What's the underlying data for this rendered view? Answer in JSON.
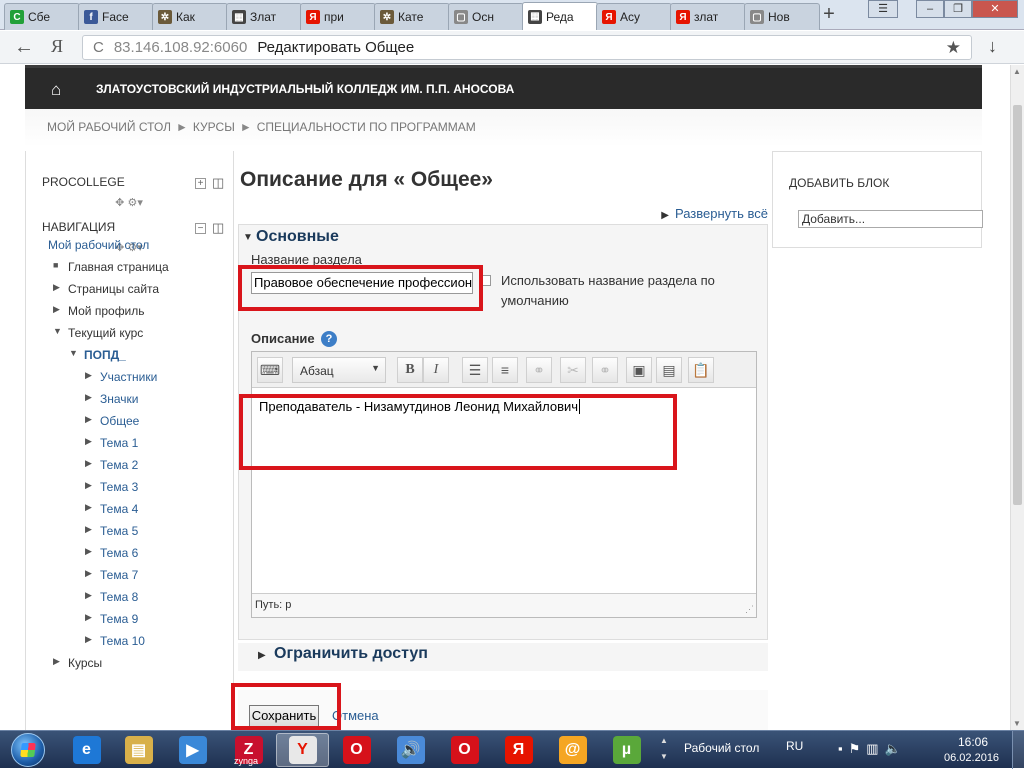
{
  "browser": {
    "tabs": [
      {
        "label": "Сбе",
        "icon": "sberbank-icon",
        "color": "#21a038",
        "glyph": "С"
      },
      {
        "label": "Face",
        "icon": "facebook-icon",
        "color": "#3b5998",
        "glyph": "f"
      },
      {
        "label": "Как",
        "icon": "puzzle-icon",
        "color": "#6b5a3a",
        "glyph": "✲"
      },
      {
        "label": "Злат",
        "icon": "moodle-icon",
        "color": "#444444",
        "glyph": "▦"
      },
      {
        "label": "при",
        "icon": "yandex-icon",
        "color": "#e61400",
        "glyph": "Я"
      },
      {
        "label": "Кате",
        "icon": "puzzle-icon",
        "color": "#6b5a3a",
        "glyph": "✲"
      },
      {
        "label": "Осн",
        "icon": "page-icon",
        "color": "#888888",
        "glyph": "▢"
      },
      {
        "label": "Реда",
        "icon": "moodle-icon",
        "color": "#444444",
        "glyph": "▦",
        "active": true
      },
      {
        "label": "Асу",
        "icon": "yandex-icon",
        "color": "#e61400",
        "glyph": "Я"
      },
      {
        "label": "злат",
        "icon": "yandex-icon",
        "color": "#e61400",
        "glyph": "Я"
      },
      {
        "label": "Нов",
        "icon": "page-icon",
        "color": "#888888",
        "glyph": "▢"
      }
    ],
    "new_tab": "+",
    "back": "←",
    "yandex_logo": "Я",
    "reload": "C",
    "url_host": "83.146.108.92:6060",
    "url_title": "Редактировать Общее",
    "star": "★",
    "download": "↓"
  },
  "site": {
    "home_icon": "⌂",
    "name": "Златоустовский индустриальный колледж им. П.П. Аносова"
  },
  "breadcrumbs": [
    "Мой рабочий стол",
    "Курсы",
    "Специальности по программам"
  ],
  "breadcrumb_sep": "►",
  "sidebar": {
    "block1_title": "PROCOLLEGE",
    "block2_title": "Навигация",
    "move_glyph": "✥",
    "gear_glyph": "⚙",
    "dropdown_glyph": "▾",
    "add_glyph": "+",
    "minus_glyph": "−",
    "dock_glyph": "◫",
    "items": [
      {
        "label": "Мой рабочий стол",
        "style": "blue",
        "bullet": ""
      },
      {
        "label": "Главная страница",
        "style": "dark",
        "bullet": "■"
      },
      {
        "label": "Страницы сайта",
        "style": "dark",
        "bullet": "▶"
      },
      {
        "label": "Мой профиль",
        "style": "dark",
        "bullet": "▶"
      },
      {
        "label": "Текущий курс",
        "style": "dark",
        "bullet": "▼"
      },
      {
        "label": "ПОПД_",
        "style": "blue-bold",
        "bullet": "▼"
      },
      {
        "label": "Участники",
        "style": "blue",
        "bullet": "▶"
      },
      {
        "label": "Значки",
        "style": "blue",
        "bullet": "▶"
      },
      {
        "label": "Общее",
        "style": "blue",
        "bullet": "▶"
      },
      {
        "label": "Тема 1",
        "style": "blue",
        "bullet": "▶"
      },
      {
        "label": "Тема 2",
        "style": "blue",
        "bullet": "▶"
      },
      {
        "label": "Тема 3",
        "style": "blue",
        "bullet": "▶"
      },
      {
        "label": "Тема 4",
        "style": "blue",
        "bullet": "▶"
      },
      {
        "label": "Тема 5",
        "style": "blue",
        "bullet": "▶"
      },
      {
        "label": "Тема 6",
        "style": "blue",
        "bullet": "▶"
      },
      {
        "label": "Тема 7",
        "style": "blue",
        "bullet": "▶"
      },
      {
        "label": "Тема 8",
        "style": "blue",
        "bullet": "▶"
      },
      {
        "label": "Тема 9",
        "style": "blue",
        "bullet": "▶"
      },
      {
        "label": "Тема 10",
        "style": "blue",
        "bullet": "▶"
      },
      {
        "label": "Курсы",
        "style": "dark",
        "bullet": "▶"
      }
    ]
  },
  "main": {
    "title": "Описание для « Общее»",
    "expand_all": "Развернуть всё",
    "expand_glyph": "▶",
    "section_general": "Основные",
    "collapse_glyph": "▼",
    "name_label": "Название раздела",
    "name_value": "Правовое обеспечение профессиональной деятельности",
    "use_default_label": "Использовать название раздела по умолчанию",
    "use_default_checked": false,
    "description_label": "Описание",
    "help_glyph": "?",
    "editor": {
      "format_value": "Абзац",
      "format_arrow": "▼",
      "buttons": [
        {
          "name": "toolbar-toggle-icon",
          "glyph": "⌨",
          "disabled": false
        },
        {
          "name": "bold-icon",
          "glyph": "B",
          "disabled": false
        },
        {
          "name": "italic-icon",
          "glyph": "I",
          "disabled": false
        },
        {
          "name": "bullet-list-icon",
          "glyph": "☰",
          "disabled": false
        },
        {
          "name": "numbered-list-icon",
          "glyph": "≡",
          "disabled": false
        },
        {
          "name": "link-icon",
          "glyph": "⚭",
          "disabled": true
        },
        {
          "name": "unlink-icon",
          "glyph": "✂",
          "disabled": true
        },
        {
          "name": "anchor-icon",
          "glyph": "⚭",
          "disabled": true
        },
        {
          "name": "image-icon",
          "glyph": "▣",
          "disabled": false
        },
        {
          "name": "media-icon",
          "glyph": "▤",
          "disabled": false
        },
        {
          "name": "paste-icon",
          "glyph": "📋",
          "disabled": false
        }
      ],
      "content": "Преподаватель - Низамутдинов Леонид Михайлович",
      "path_label": "Путь: p",
      "resize_glyph": "⋰"
    },
    "section_restrict": "Ограничить доступ",
    "save_label": "Сохранить",
    "cancel_label": "Отмена"
  },
  "right_block": {
    "title": "Добавить блок",
    "select_value": "Добавить..."
  },
  "taskbar": {
    "apps": [
      {
        "name": "internet-explorer-icon",
        "color": "#1e78d6",
        "glyph": "e",
        "active": false
      },
      {
        "name": "file-explorer-icon",
        "color": "#d8b04a",
        "glyph": "▤",
        "active": false
      },
      {
        "name": "media-player-icon",
        "color": "#3a88d8",
        "glyph": "▶",
        "active": false
      },
      {
        "name": "zynga-icon",
        "color": "#c8102e",
        "glyph": "Z",
        "active": false
      },
      {
        "name": "yandex-browser-icon",
        "color": "#e8e8e8",
        "glyph": "Y",
        "active": true
      },
      {
        "name": "opera-icon",
        "color": "#d6111a",
        "glyph": "O",
        "active": false
      },
      {
        "name": "speaker-app-icon",
        "color": "#4a8ad8",
        "glyph": "🔊",
        "active": false
      },
      {
        "name": "opera-icon",
        "color": "#d6111a",
        "glyph": "O",
        "active": false
      },
      {
        "name": "yandex-icon",
        "color": "#e61400",
        "glyph": "Я",
        "active": false
      },
      {
        "name": "mail-agent-icon",
        "color": "#f5a623",
        "glyph": "@",
        "active": false
      },
      {
        "name": "utorrent-icon",
        "color": "#5aa83a",
        "glyph": "µ",
        "active": false
      }
    ],
    "zynga_label": "zynga",
    "desktop_label": "Рабочий стол",
    "lang": "RU",
    "time": "16:06",
    "date": "06.02.2016"
  },
  "colors": {
    "highlight_box": "#d9151b",
    "header_bg": "#2a2a2a",
    "link": "#2a5d93"
  }
}
